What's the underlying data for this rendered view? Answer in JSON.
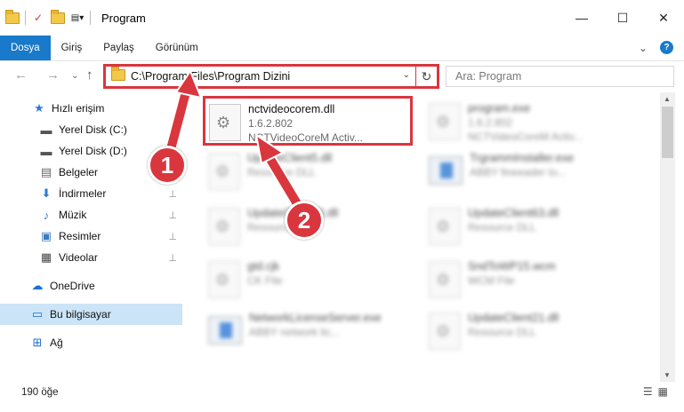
{
  "window": {
    "title": "Program",
    "minimize": "—",
    "maximize": "☐",
    "close": "✕"
  },
  "ribbon": {
    "tabs": [
      {
        "label": "Dosya",
        "active": true
      },
      {
        "label": "Giriş",
        "active": false
      },
      {
        "label": "Paylaş",
        "active": false
      },
      {
        "label": "Görünüm",
        "active": false
      }
    ],
    "collapse": "⌄",
    "help": "?"
  },
  "nav": {
    "back": "←",
    "forward": "→",
    "recent": "⌄",
    "up": "↑",
    "address": "C:\\Program Files\\Program Dizini",
    "dropdown": "⌄",
    "refresh": "↻",
    "search_placeholder": "Ara: Program"
  },
  "sidebar": {
    "items": [
      {
        "label": "Hızlı erişim",
        "icon": "star-icon",
        "glyph": "★",
        "pinned": false
      },
      {
        "label": "Yerel Disk (C:)",
        "icon": "drive-icon",
        "glyph": "▬",
        "pinned": true
      },
      {
        "label": "Yerel Disk (D:)",
        "icon": "drive-icon",
        "glyph": "▬",
        "pinned": true
      },
      {
        "label": "Belgeler",
        "icon": "documents-icon",
        "glyph": "▤",
        "pinned": true
      },
      {
        "label": "İndirmeler",
        "icon": "download-icon",
        "glyph": "⬇",
        "pinned": true
      },
      {
        "label": "Müzik",
        "icon": "music-icon",
        "glyph": "♪",
        "pinned": true
      },
      {
        "label": "Resimler",
        "icon": "pictures-icon",
        "glyph": "▣",
        "pinned": true
      },
      {
        "label": "Videolar",
        "icon": "videos-icon",
        "glyph": "▦",
        "pinned": true
      },
      {
        "label": "OneDrive",
        "icon": "cloud-icon",
        "glyph": "☁",
        "pinned": false
      },
      {
        "label": "Bu bilgisayar",
        "icon": "computer-icon",
        "glyph": "▭",
        "pinned": false,
        "selected": true
      },
      {
        "label": "Ağ",
        "icon": "network-icon",
        "glyph": "⊞",
        "pinned": false
      }
    ],
    "pin_glyph": "📌"
  },
  "files": [
    {
      "name": "nctvideocorem.dll",
      "line2": "1.6.2.802",
      "line3": "NCTVideoCoreM Activ...",
      "kind": "gear",
      "highlight": true
    },
    {
      "name": "program.exe",
      "line2": "1.6.2.802",
      "line3": "NCTVideoCoreM Activ...",
      "kind": "exe"
    },
    {
      "name": "UpdateClient5.dll",
      "line2": "Resource DLL",
      "line3": "",
      "kind": "gear"
    },
    {
      "name": "TrgrammInstaller.exe",
      "line2": "ABBY fineeader to...",
      "line3": "",
      "kind": "win"
    },
    {
      "name": "UpdateClient63.dll",
      "line2": "Resource DLL",
      "line3": "",
      "kind": "gear"
    },
    {
      "name": "UpdateClient63.dll",
      "line2": "Resource DLL",
      "line3": "",
      "kind": "gear"
    },
    {
      "name": "gtd.cjk",
      "line2": "CK File",
      "line3": "",
      "kind": "gear"
    },
    {
      "name": "SndToWP15.wcm",
      "line2": "WCM File",
      "line3": "",
      "kind": "gear"
    },
    {
      "name": "NetworkLicenseServer.exe",
      "line2": "ABBY network lic...",
      "line3": "",
      "kind": "win"
    },
    {
      "name": "UpdateClient21.dll",
      "line2": "Resource DLL",
      "line3": "",
      "kind": "gear"
    }
  ],
  "status": {
    "count": "190 öğe",
    "details_view": "☰",
    "tiles_view": "▦"
  },
  "annotations": {
    "one": "1",
    "two": "2",
    "color": "#d9363e"
  }
}
